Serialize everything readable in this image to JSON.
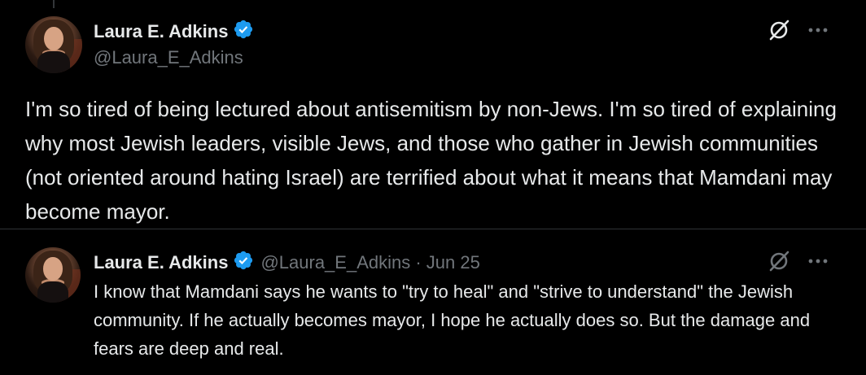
{
  "main_tweet": {
    "display_name": "Laura E. Adkins",
    "handle": "@Laura_E_Adkins",
    "text": "I'm so tired of being lectured about antisemitism by non-Jews. I'm so tired of explaining why most Jewish leaders, visible Jews, and those who gather in Jewish communities (not oriented around hating Israel) are terrified about what it means that Mamdani may become mayor.",
    "icons": {
      "verified": "verified-badge-icon",
      "grok": "grok-icon",
      "more": "more-options-icon"
    }
  },
  "quoted_tweet": {
    "display_name": "Laura E. Adkins",
    "handle_date": "@Laura_E_Adkins · Jun 25",
    "text": "I know that Mamdani says he wants to \"try to heal\" and \"strive to understand\" the Jewish community. If he actually becomes mayor, I hope he actually does so. But the damage and fears are deep and real.",
    "icons": {
      "verified": "verified-badge-icon",
      "grok": "grok-icon",
      "more": "more-options-icon"
    }
  },
  "colors": {
    "background": "#000000",
    "text_primary": "#e7e9ea",
    "text_secondary": "#71767b",
    "verified": "#1d9bf0",
    "divider": "#2f3336"
  }
}
